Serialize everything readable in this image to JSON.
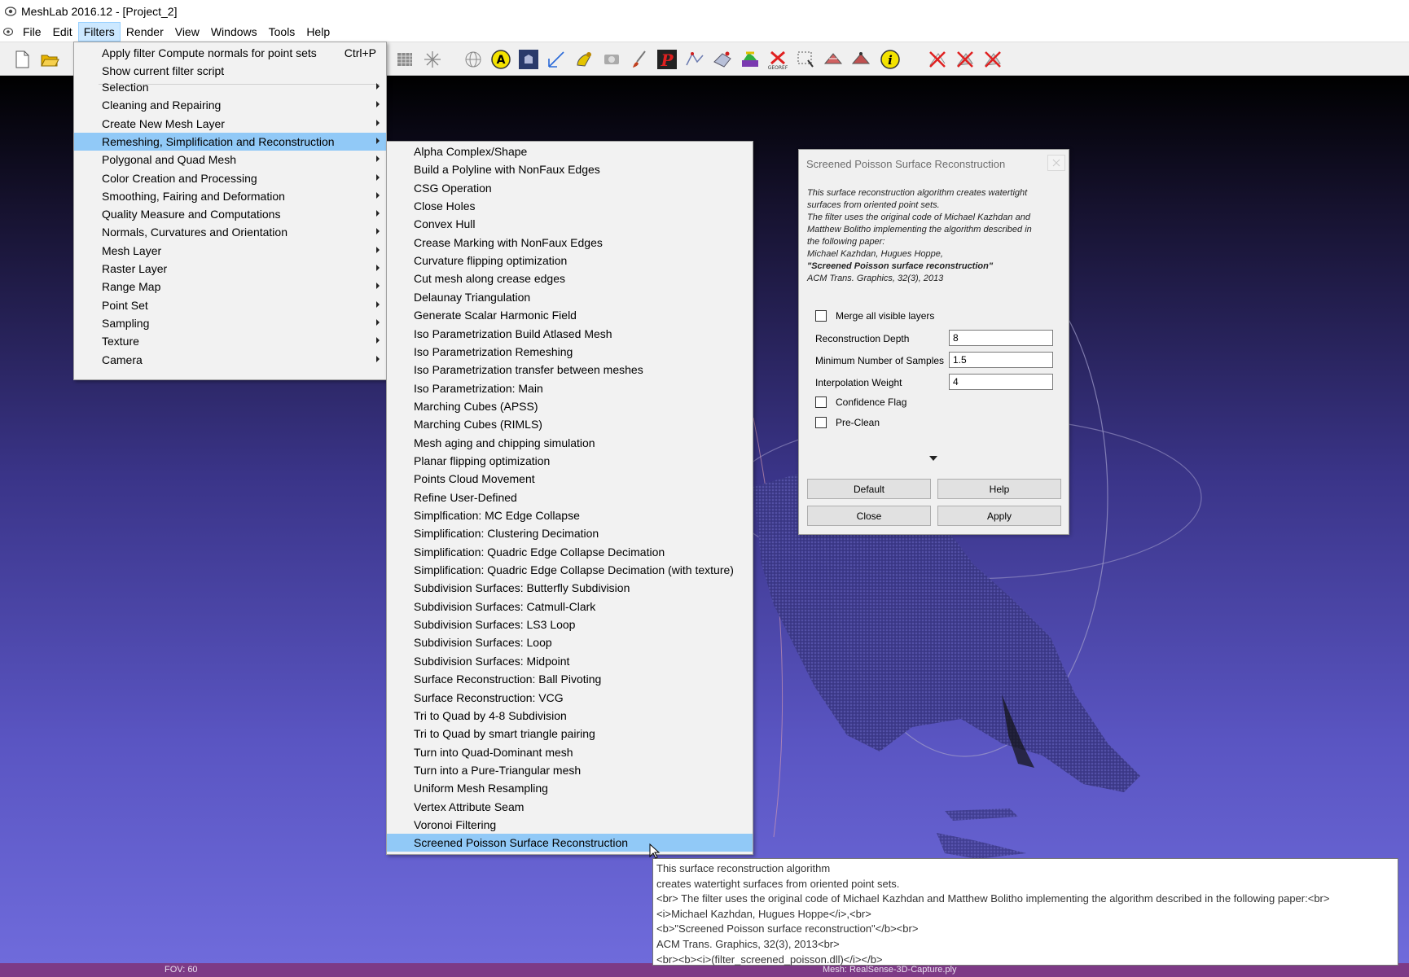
{
  "window": {
    "title": "MeshLab 2016.12 - [Project_2]"
  },
  "menubar": {
    "items": [
      {
        "label": "File",
        "active": false
      },
      {
        "label": "Edit",
        "active": false
      },
      {
        "label": "Filters",
        "active": true
      },
      {
        "label": "Render",
        "active": false
      },
      {
        "label": "View",
        "active": false
      },
      {
        "label": "Windows",
        "active": false
      },
      {
        "label": "Tools",
        "active": false
      },
      {
        "label": "Help",
        "active": false
      }
    ]
  },
  "filters_menu": {
    "apply_label": "Apply filter Compute normals for point sets",
    "apply_shortcut": "Ctrl+P",
    "show_script_label": "Show current filter script",
    "categories": [
      "Selection",
      "Cleaning and Repairing",
      "Create New Mesh Layer",
      "Remeshing, Simplification and Reconstruction",
      "Polygonal and Quad Mesh",
      "Color Creation and Processing",
      "Smoothing, Fairing and Deformation",
      "Quality Measure and Computations",
      "Normals, Curvatures and Orientation",
      "Mesh Layer",
      "Raster Layer",
      "Range Map",
      "Point Set",
      "Sampling",
      "Texture",
      "Camera"
    ],
    "highlighted_category": "Remeshing, Simplification and Reconstruction"
  },
  "submenu": {
    "items": [
      "Alpha Complex/Shape",
      "Build a Polyline with NonFaux Edges",
      "CSG Operation",
      "Close Holes",
      "Convex Hull",
      "Crease Marking with NonFaux Edges",
      "Curvature flipping optimization",
      "Cut mesh along crease edges",
      "Delaunay Triangulation",
      "Generate Scalar Harmonic Field",
      "Iso Parametrization Build Atlased Mesh",
      "Iso Parametrization Remeshing",
      "Iso Parametrization transfer between meshes",
      "Iso Parametrization: Main",
      "Marching Cubes (APSS)",
      "Marching Cubes (RIMLS)",
      "Mesh aging and chipping simulation",
      "Planar flipping optimization",
      "Points Cloud Movement",
      "Refine User-Defined",
      "Simplfication: MC Edge Collapse",
      "Simplification: Clustering Decimation",
      "Simplification: Quadric Edge Collapse Decimation",
      "Simplification: Quadric Edge Collapse Decimation (with texture)",
      "Subdivision Surfaces: Butterfly Subdivision",
      "Subdivision Surfaces: Catmull-Clark",
      "Subdivision Surfaces: LS3 Loop",
      "Subdivision Surfaces: Loop",
      "Subdivision Surfaces: Midpoint",
      "Surface Reconstruction: Ball Pivoting",
      "Surface Reconstruction: VCG",
      "Tri to Quad by 4-8 Subdivision",
      "Tri to Quad by smart triangle pairing",
      "Turn into Quad-Dominant mesh",
      "Turn into a Pure-Triangular mesh",
      "Uniform Mesh Resampling",
      "Vertex Attribute Seam",
      "Voronoi Filtering",
      "Screened Poisson Surface Reconstruction"
    ],
    "highlighted_item": "Screened Poisson Surface Reconstruction"
  },
  "dialog": {
    "title": "Screened Poisson Surface Reconstruction",
    "description": {
      "line1": "This surface reconstruction algorithm creates watertight",
      "line2": "surfaces from oriented point sets.",
      "line3": "The filter uses the original code of Michael Kazhdan and",
      "line4": "Matthew Bolitho implementing the algorithm described in",
      "line5": "the following paper:",
      "line6": "Michael Kazhdan, Hugues Hoppe,",
      "line7": "\"Screened Poisson surface reconstruction\"",
      "line8": "ACM Trans. Graphics, 32(3), 2013"
    },
    "merge_layers": {
      "label": "Merge all visible layers",
      "checked": false
    },
    "reconstruction_depth": {
      "label": "Reconstruction Depth",
      "value": "8"
    },
    "min_samples": {
      "label": "Minimum Number of Samples",
      "value": "1.5"
    },
    "interpolation_weight": {
      "label": "Interpolation Weight",
      "value": "4"
    },
    "confidence_flag": {
      "label": "Confidence Flag",
      "checked": false
    },
    "pre_clean": {
      "label": "Pre-Clean",
      "checked": false
    },
    "buttons": {
      "default": "Default",
      "help": "Help",
      "close": "Close",
      "apply": "Apply"
    }
  },
  "tooltip": {
    "lines": [
      "This surface reconstruction algorithm",
      "creates watertight surfaces from oriented point sets.",
      "<br> The filter uses the original code of Michael Kazhdan and Matthew Bolitho implementing the algorithm described in the following paper:<br>",
      "<i>Michael Kazhdan, Hugues Hoppe</i>,<br>",
      "<b>\"Screened Poisson surface reconstruction\"</b><br>",
      "ACM Trans. Graphics, 32(3), 2013<br>",
      "<br><b><i>(filter_screened_poisson.dll)</i></b>"
    ]
  },
  "statusbar": {
    "fov": "FOV: 60",
    "mesh": "Mesh: RealSense-3D-Capture.ply"
  },
  "colors": {
    "menu_highlight": "#91c9f7",
    "statusbar": "#7d3a86",
    "viewport_bottom": "#6f6bdb"
  },
  "toolbar_icons": [
    "new-document-icon",
    "open-folder-icon",
    "layers-icon",
    "axis-move-icon",
    "sphere-wire-icon",
    "annotation-a-icon",
    "dark-cube-icon",
    "measure-icon",
    "hand-pick-icon",
    "camera-align-icon",
    "paint-brush-icon",
    "red-p-icon",
    "point-pick-icon",
    "mesh-align-icon",
    "color-paint-icon",
    "georef-icon",
    "select-region-icon",
    "select-faces-icon",
    "select-vertices-icon",
    "info-icon",
    "delete-faces-icon",
    "delete-vertices-icon",
    "delete-all-icon"
  ]
}
